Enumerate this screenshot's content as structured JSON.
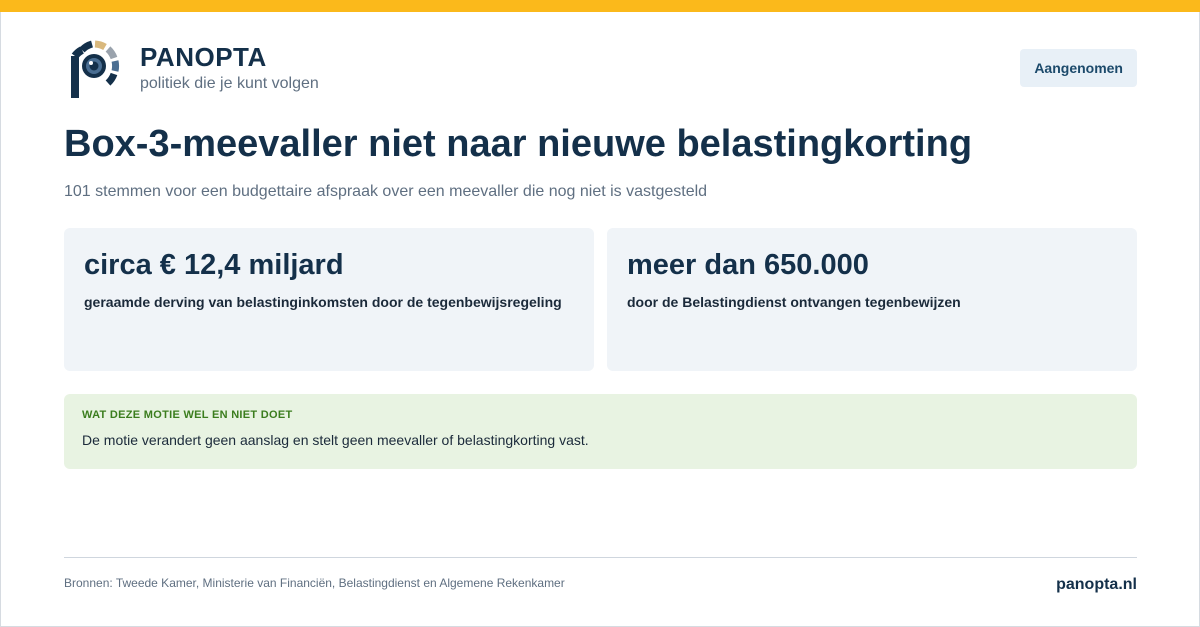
{
  "brand": {
    "name": "PANOPTA",
    "tagline": "politiek die je kunt volgen",
    "logo_icon": "panopta-eye-logo-icon",
    "colors": {
      "navy": "#14304a",
      "gold": "#fbb91b",
      "sand": "#d9b87c",
      "gray": "#9aa3ad",
      "eye_blue": "#4a6e92"
    }
  },
  "status": {
    "label": "Aangenomen"
  },
  "headline": "Box-3-meevaller niet naar nieuwe belastingkorting",
  "subline": "101 stemmen voor een budgettaire afspraak over een meevaller die nog niet is vastgesteld",
  "stats": [
    {
      "value": "circa € 12,4 miljard",
      "description": "geraamde derving van belastinginkomsten door de tegenbewijsregeling"
    },
    {
      "value": "meer dan 650.000",
      "description": "door de Belastingdienst ontvangen tegenbewijzen"
    }
  ],
  "info": {
    "heading": "WAT DEZE MOTIE WEL EN NIET DOET",
    "text": "De motie verandert geen aanslag en stelt geen meevaller of belastingkorting vast."
  },
  "footer": {
    "sources": "Bronnen: Tweede Kamer, Ministerie van Financiën, Belastingdienst en Algemene Rekenkamer",
    "site": "panopta.nl"
  },
  "accent_colors": {
    "top_bar": "#fbb91b",
    "badge_bg": "#e8f0f7",
    "card_bg": "#f0f4f8",
    "info_bg": "#e8f3e2",
    "info_heading": "#3b7d1e"
  }
}
